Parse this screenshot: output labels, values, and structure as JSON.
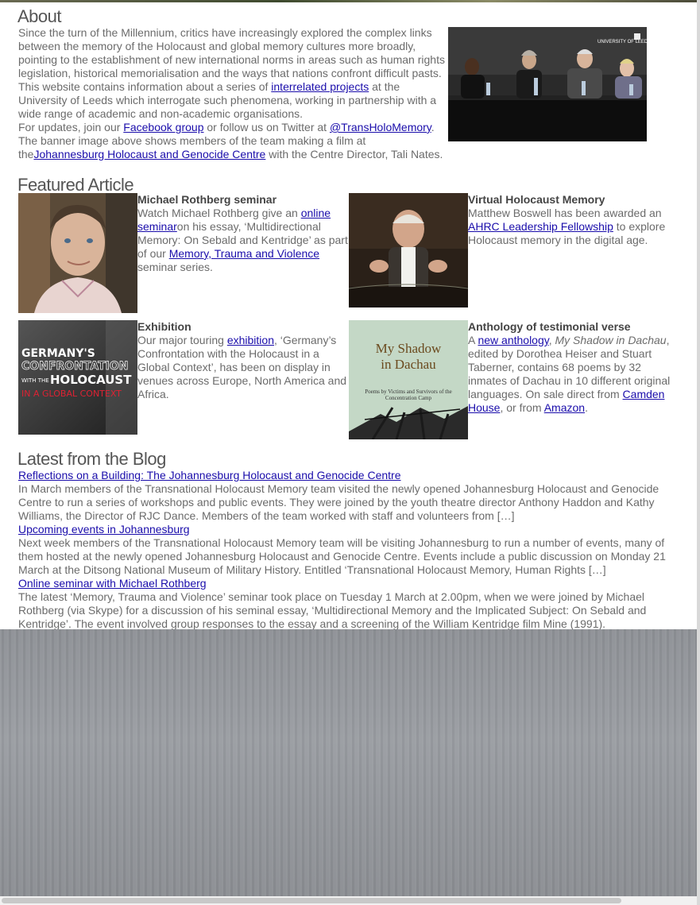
{
  "about": {
    "title": "About",
    "p1": "Since the turn of the Millennium, critics have increasingly explored the complex  links between the memory of the Holocaust and global memory cultures more broadly, pointing to the establishment of new international norms in areas such as human rights legislation, historical memorialisation and the ways that nations confront difficult pasts.  This website contains information about a  series of ",
    "link_projects": "interrelated projects",
    "p1b": " at the University of Leeds which interrogate such phenomena, working in partnership with a wide range of academic and non-academic organisations.",
    "p2a": "For updates, join our  ",
    "link_facebook": "Facebook group",
    "p2b": "  or follow us on Twitter at  ",
    "link_twitter": "@TransHoloMemory",
    "p2c": ".",
    "p3a": "The banner image above shows members of the team making a film at the",
    "link_jhgc": "Johannesburg Holocaust and Genocide Centre",
    "p3b": "  with the Centre Director, Tali Nates.",
    "banner_logo": "UNIVERSITY OF LEEDS"
  },
  "featured": {
    "title": "Featured Article",
    "rothberg": {
      "heading": "Michael Rothberg seminar",
      "t1": "Watch Michael Rothberg give an  ",
      "link1": "online seminar",
      "t2": "on his essay, ‘Multidirectional Memory: On Sebald and Kentridge’ as part of our  ",
      "link2": "Memory, Trauma and Violence",
      "t3": "  seminar series."
    },
    "virtual": {
      "heading": "Virtual Holocaust Memory",
      "t1": "Matthew Boswell has been awarded an  ",
      "link1": "AHRC Leadership Fellowship",
      "t2": "  to explore Holocaust memory in the digital age."
    },
    "exhibition": {
      "heading": "Exhibition",
      "t1": "Our major touring  ",
      "link1": "exhibition",
      "t2": ", ‘Germany’s Confrontation with the Holocaust in a Global Context’, has been on display in venues across Europe, North America and Africa.",
      "poster_l1": "GERMANY'S",
      "poster_l2": "CONFRONTATION",
      "poster_l3a": "WITH THE",
      "poster_l3b": "HOLOCAUST",
      "poster_l4": "IN A GLOBAL CONTEXT"
    },
    "anthology": {
      "heading": "Anthology of testimonial verse",
      "t1": "A  ",
      "link1": "new anthology",
      "t2": ",  ",
      "italic": "My Shadow in Dachau",
      "t3": ", edited by Dorothea Heiser and Stuart Taberner, contains 68 poems by 32 inmates of Dachau in 10 different original languages. On sale direct from  ",
      "link2": "Camden House",
      "t4": ", or from  ",
      "link3": "Amazon",
      "t5": ".",
      "cover_title1": "My Shadow",
      "cover_title2": "in Dachau",
      "cover_sub": "Poems by Victims and Survivors of the Concentration Camp"
    }
  },
  "blog": {
    "title": "Latest from the Blog",
    "posts": [
      {
        "title": "Reflections on a Building: The Johannesburg Holocaust and Genocide Centre",
        "excerpt": "In March members of the Transnational Holocaust Memory team visited the newly opened Johannesburg Holocaust and Genocide Centre to run a series of workshops and public events. They were joined by the youth theatre director Anthony Haddon and Kathy Williams, the Director of RJC Dance. Members of the team worked with staff and volunteers from […]"
      },
      {
        "title": "Upcoming events in Johannesburg",
        "excerpt": "Next week members of the Transnational Holocaust Memory team will be visiting Johannesburg to run a number of events, many of them hosted at the newly opened Johannesburg Holocaust and Genocide Centre. Events include a public discussion on Monday 21 March at the Ditsong National Museum of Military History. Entitled ‘Transnational Holocaust Memory, Human Rights […]"
      },
      {
        "title": "Online seminar with Michael Rothberg",
        "excerpt": "The latest ‘Memory, Trauma and Violence’ seminar took  place on Tuesday 1 March at 2.00pm, when we were joined by Michael Rothberg (via Skype) for a discussion of his seminal essay,  ‘Multidirectional Memory and the Implicated Subject: On Sebald and Kentridge’.  The event involved group responses to the essay and a screening of the William Kentridge film  Mine  (1991)."
      }
    ]
  },
  "colors": {
    "link": "#1a0dab",
    "text": "#6b6b6b",
    "heading": "#555555"
  }
}
